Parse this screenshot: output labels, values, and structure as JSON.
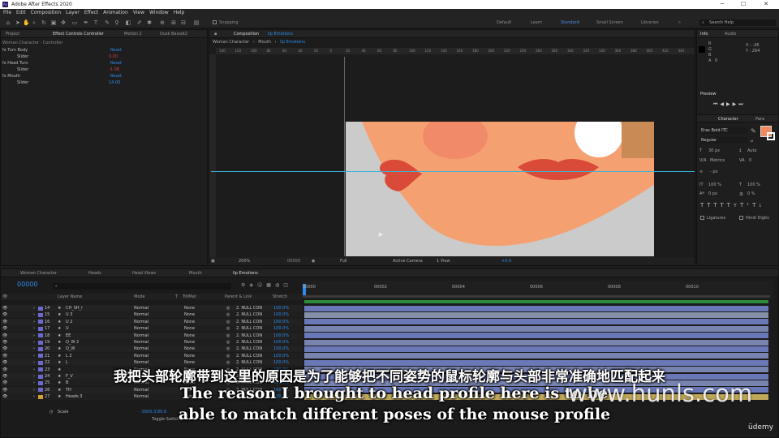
{
  "app": {
    "title": "Adobe After Effects 2020",
    "icon_label": "Ae"
  },
  "window_controls": {
    "minimize": "─",
    "maximize": "☐",
    "close": "✕"
  },
  "menu": [
    "File",
    "Edit",
    "Composition",
    "Layer",
    "Effect",
    "Animation",
    "View",
    "Window",
    "Help"
  ],
  "toolbar": {
    "snapping_label": "Snapping",
    "workspaces": [
      "Default",
      "Learn",
      "Standard",
      "Small Screen",
      "Libraries"
    ],
    "active_workspace": "Standard",
    "search_placeholder": "Search Help"
  },
  "left_panel": {
    "tabs": [
      "Project",
      "Effect Controls Controller",
      "Motion 2",
      "Dusk Basset2"
    ],
    "subtitle": "Woman Character · Controller",
    "rows": [
      {
        "name": "fx  Turn Body",
        "value": "Reset"
      },
      {
        "name": "Slider",
        "value": "0.00"
      },
      {
        "name": "fx  Head Turn",
        "value": "Reset"
      },
      {
        "name": "Slider",
        "value": "-1.08"
      },
      {
        "name": "fx  Mouth",
        "value": "Reset"
      },
      {
        "name": "Slider",
        "value": "14.00"
      }
    ]
  },
  "comp_panel": {
    "tab_label": "Composition",
    "tab_comp": "lip Emotions",
    "breadcrumbs": [
      "Woman Character",
      "Mouth",
      "lip Emotions"
    ],
    "ruler_ticks": [
      "140",
      "120",
      "100",
      "80",
      "60",
      "40",
      "20",
      "0",
      "20",
      "40",
      "60",
      "80",
      "100",
      "120",
      "140",
      "160",
      "180",
      "200",
      "220",
      "240",
      "260",
      "280",
      "300",
      "320",
      "340",
      "360",
      "380",
      "400",
      "420",
      "440"
    ],
    "footer": {
      "zoom": "200%",
      "timecode": "00000",
      "resolution": "Full",
      "camera": "Active Camera",
      "view": "1 View",
      "exposure": "+0.0"
    }
  },
  "right_panel": {
    "info_tabs": [
      "Info",
      "Audio"
    ],
    "info_values": {
      "r": "R",
      "g": "G",
      "b": "B",
      "a": "A",
      "a_val": "0",
      "x": "X : -26",
      "y": "Y : 264"
    },
    "preview_label": "Preview",
    "character_tabs": [
      "Character",
      "Para"
    ],
    "font_name": "Eras Bold ITC",
    "font_style": "Regular",
    "font_size": "30 px",
    "leading": "Auto",
    "kerning": "Metrics",
    "tracking": "0",
    "stroke": "- px",
    "v_scale": "100 %",
    "h_scale": "100 %",
    "baseline": "0 px",
    "tsume": "0 %",
    "ligatures": "Ligatures",
    "hindi_digits": "Hindi Digits",
    "fill_color": "#f3875e"
  },
  "timeline": {
    "tabs": [
      "Woman Character",
      "Heads",
      "Head Views",
      "Mouth",
      "lip Emotions"
    ],
    "active_tab": "lip Emotions",
    "timecode": "00000",
    "search_placeholder": "",
    "columns": [
      "Layer Name",
      "Mode",
      "T",
      "TrkMat",
      "Parent & Link",
      "Stretch"
    ],
    "time_ticks": [
      "00000",
      "00002",
      "00004",
      "00006",
      "00008",
      "00010"
    ],
    "layers": [
      {
        "num": "14",
        "name": "CH_SH_I",
        "mode": "Normal",
        "trkmat": "None",
        "parent": "2. NULL CON",
        "stretch": "100.0%",
        "color": "#6a6ad0"
      },
      {
        "num": "15",
        "name": "U 3",
        "mode": "Normal",
        "trkmat": "None",
        "parent": "2. NULL CON",
        "stretch": "100.0%",
        "color": "#6a6ad0"
      },
      {
        "num": "16",
        "name": "U 2",
        "mode": "Normal",
        "trkmat": "None",
        "parent": "2. NULL CON",
        "stretch": "100.0%",
        "color": "#6a6ad0"
      },
      {
        "num": "17",
        "name": "U",
        "mode": "Normal",
        "trkmat": "None",
        "parent": "2. NULL CON",
        "stretch": "100.0%",
        "color": "#6a6ad0"
      },
      {
        "num": "18",
        "name": "EE",
        "mode": "Normal",
        "trkmat": "None",
        "parent": "2. NULL CON",
        "stretch": "100.0%",
        "color": "#6a6ad0"
      },
      {
        "num": "19",
        "name": "Q_W 2",
        "mode": "Normal",
        "trkmat": "None",
        "parent": "2. NULL CON",
        "stretch": "100.0%",
        "color": "#6a6ad0"
      },
      {
        "num": "20",
        "name": "Q_W",
        "mode": "Normal",
        "trkmat": "None",
        "parent": "2. NULL CON",
        "stretch": "100.0%",
        "color": "#6a6ad0"
      },
      {
        "num": "21",
        "name": "L 2",
        "mode": "Normal",
        "trkmat": "None",
        "parent": "2. NULL CON",
        "stretch": "100.0%",
        "color": "#6a6ad0"
      },
      {
        "num": "22",
        "name": "L",
        "mode": "Normal",
        "trkmat": "None",
        "parent": "2. NULL CON",
        "stretch": "100.0%",
        "color": "#6a6ad0"
      },
      {
        "num": "23",
        "name": "",
        "mode": "Normal",
        "trkmat": "None",
        "parent": "2. NULL CON",
        "stretch": "100.0%",
        "color": "#6a6ad0"
      },
      {
        "num": "24",
        "name": "F_V",
        "mode": "Normal",
        "trkmat": "None",
        "parent": "2. NULL CON",
        "stretch": "100.0%",
        "color": "#6a6ad0"
      },
      {
        "num": "25",
        "name": "B",
        "mode": "Normal",
        "trkmat": "None",
        "parent": "2. NULL CON",
        "stretch": "100.0%",
        "color": "#6a6ad0"
      },
      {
        "num": "26",
        "name": "TH",
        "mode": "Normal",
        "trkmat": "None",
        "parent": "2. NULL CON",
        "stretch": "100.0%",
        "color": "#6a6ad0"
      },
      {
        "num": "27",
        "name": "Heads 3",
        "mode": "Normal",
        "trkmat": "None",
        "parent": "2. NULL CON",
        "stretch": "100.0%",
        "color": "#d0a030"
      }
    ],
    "scale_row": {
      "label": "Scale",
      "value": "-3500.3,80.6"
    },
    "toggle_label": "Toggle Switch"
  },
  "subtitles": {
    "zh": "我把头部轮廓带到这里的原因是为了能够把不同姿势的鼠标轮廓与头部非常准确地匹配起来",
    "en_line1": "The reason I brought to head profile here is to be",
    "en_line2": "able to match different poses of the mouse profile"
  },
  "watermark": "www.hunls.com",
  "brand": "ūdemy",
  "colors": {
    "skin": "#f3a071",
    "lip": "#d94a38",
    "accent_blue": "#2d8ceb",
    "guide_cyan": "#3ab3d6"
  }
}
